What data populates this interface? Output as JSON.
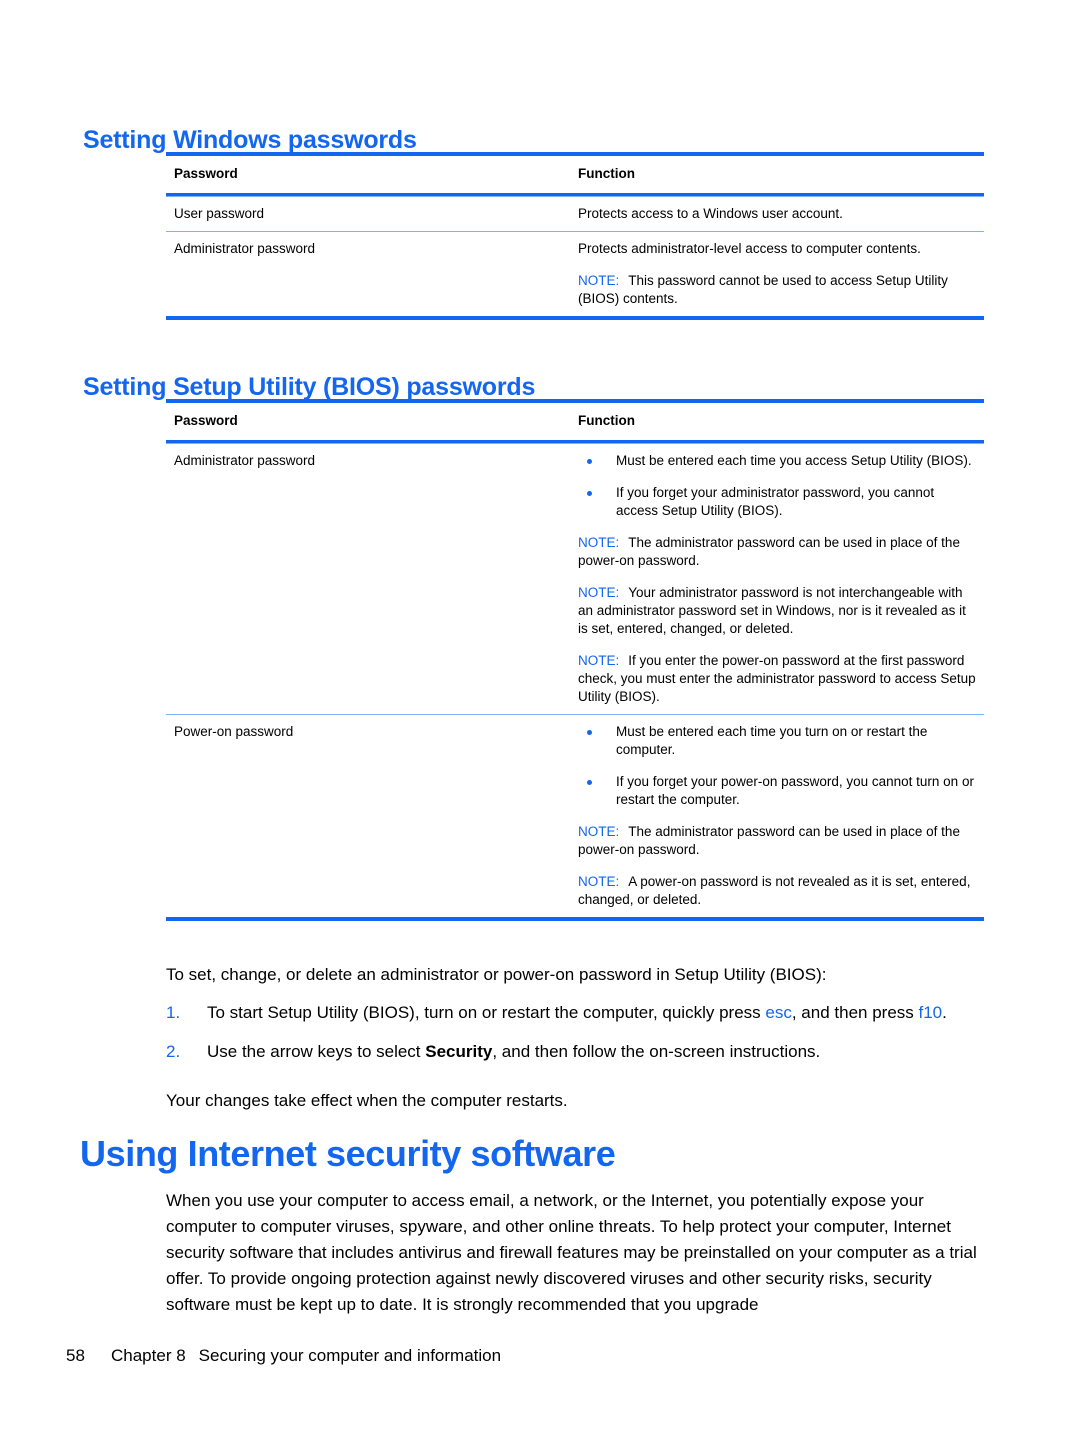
{
  "page": {
    "footer_page_number": "58",
    "footer_chapter": "Chapter 8",
    "footer_title": "Securing your computer and information"
  },
  "colors": {
    "accent_blue": "#1366ef",
    "rule_light_blue": "#7eb0f3",
    "text_black": "#000000"
  },
  "sections": {
    "windows_passwords": {
      "heading": "Setting Windows passwords",
      "table": {
        "headers": {
          "password": "Password",
          "function": "Function"
        },
        "rows": [
          {
            "password": "User password",
            "function_paragraphs": [
              {
                "note": false,
                "text": "Protects access to a Windows user account."
              }
            ]
          },
          {
            "password": "Administrator password",
            "function_paragraphs": [
              {
                "note": false,
                "text": "Protects administrator-level access to computer contents."
              },
              {
                "note": true,
                "note_label": "NOTE:",
                "text": "This password cannot be used to access Setup Utility (BIOS) contents."
              }
            ]
          }
        ]
      }
    },
    "bios_passwords": {
      "heading": "Setting Setup Utility (BIOS) passwords",
      "table": {
        "headers": {
          "password": "Password",
          "function": "Function"
        },
        "rows": [
          {
            "password": "Administrator password",
            "bullets": [
              "Must be entered each time you access Setup Utility (BIOS).",
              "If you forget your administrator password, you cannot access Setup Utility (BIOS)."
            ],
            "notes": [
              {
                "note_label": "NOTE:",
                "text": "The administrator password can be used in place of the power-on password."
              },
              {
                "note_label": "NOTE:",
                "text": "Your administrator password is not interchangeable with an administrator password set in Windows, nor is it revealed as it is set, entered, changed, or deleted."
              },
              {
                "note_label": "NOTE:",
                "text": "If you enter the power-on password at the first password check, you must enter the administrator password to access Setup Utility (BIOS)."
              }
            ]
          },
          {
            "password": "Power-on password",
            "bullets": [
              "Must be entered each time you turn on or restart the computer.",
              "If you forget your power-on password, you cannot turn on or restart the computer."
            ],
            "notes": [
              {
                "note_label": "NOTE:",
                "text": "The administrator password can be used in place of the power-on password."
              },
              {
                "note_label": "NOTE:",
                "text": "A power-on password is not revealed as it is set, entered, changed, or deleted."
              }
            ]
          }
        ]
      },
      "intro_paragraph": "To set, change, or delete an administrator or power-on password in Setup Utility (BIOS):",
      "steps": [
        {
          "number": "1.",
          "part1": "To start Setup Utility (BIOS), turn on or restart the computer, quickly press ",
          "key1": "esc",
          "part2": ", and then press ",
          "key2": "f10",
          "part3": "."
        },
        {
          "number": "2.",
          "part1": "Use the arrow keys to select ",
          "bold1": "Security",
          "part2": ", and then follow the on-screen instructions.",
          "key1": "",
          "key2": "",
          "part3": ""
        }
      ],
      "closing_paragraph": "Your changes take effect when the computer restarts."
    },
    "internet_security": {
      "heading": "Using Internet security software",
      "paragraph": "When you use your computer to access email, a network, or the Internet, you potentially expose your computer to computer viruses, spyware, and other online threats. To help protect your computer, Internet security software that includes antivirus and firewall features may be preinstalled on your computer as a trial offer. To provide ongoing protection against newly discovered viruses and other security risks, security software must be kept up to date. It is strongly recommended that you upgrade"
    }
  }
}
